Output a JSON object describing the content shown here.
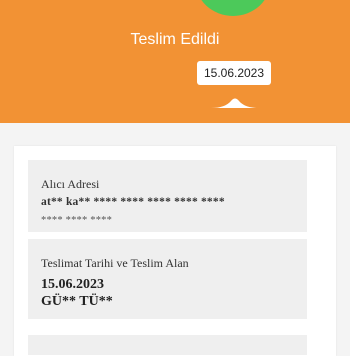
{
  "status": {
    "label": "Teslim Edildi",
    "date": "15.06.2023",
    "colors": {
      "header": "#f29234",
      "success": "#4cc95a"
    }
  },
  "address": {
    "title": "Alıcı Adresi",
    "line1": "at** ka** **** **** **** **** ****",
    "line2": "**** **** ****"
  },
  "delivery": {
    "title": "Teslimat Tarihi ve Teslim Alan",
    "date": "15.06.2023",
    "receiver": "GÜ** TÜ**"
  }
}
